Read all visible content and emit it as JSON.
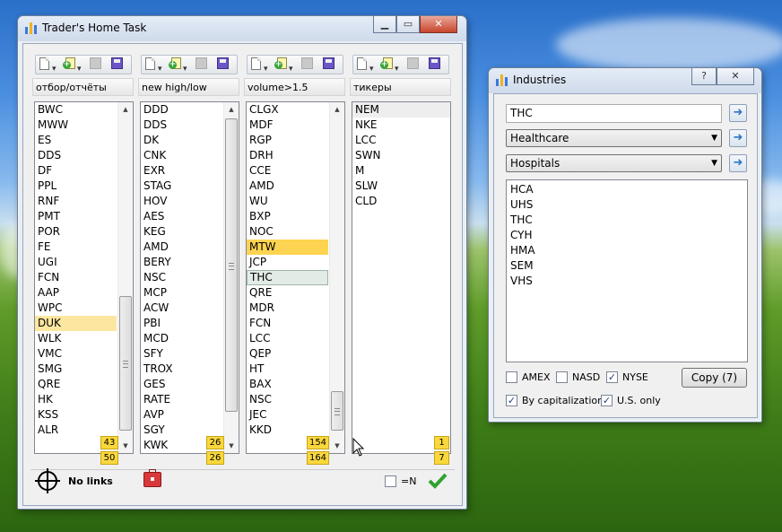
{
  "main_window": {
    "title": "Trader's Home Task",
    "columns": [
      {
        "header": "отбор/отчёты",
        "items": [
          "BWC",
          "MWW",
          "ES",
          "DDS",
          "DF",
          "PPL",
          "RNF",
          "PMT",
          "POR",
          "FE",
          "UGI",
          "FCN",
          "AAP",
          "WPC",
          "DUK",
          "WLK",
          "VMC",
          "SMG",
          "QRE",
          "HK",
          "KSS",
          "ALR"
        ],
        "selected": "DUK",
        "count_top": "43",
        "count_bottom": "50"
      },
      {
        "header": "new high/low",
        "items": [
          "DDD",
          "DDS",
          "DK",
          "CNK",
          "EXR",
          "STAG",
          "HOV",
          "AES",
          "KEG",
          "AMD",
          "BERY",
          "NSC",
          "MCP",
          "ACW",
          "PBI",
          "MCD",
          "SFY",
          "TROX",
          "GES",
          "RATE",
          "AVP",
          "SGY",
          "KWK"
        ],
        "count_top": "26",
        "count_bottom": "26"
      },
      {
        "header": "volume>1.5",
        "items": [
          "CLGX",
          "MDF",
          "RGP",
          "DRH",
          "CCE",
          "AMD",
          "WU",
          "BXP",
          "NOC",
          "MTW",
          "JCP",
          "THC",
          "QRE",
          "MDR",
          "FCN",
          "LCC",
          "QEP",
          "HT",
          "BAX",
          "NSC",
          "JEC",
          "KKD"
        ],
        "hot": "MTW",
        "focus": "THC",
        "count_top": "154",
        "count_bottom": "164"
      },
      {
        "header": "тикеры",
        "items": [
          "NEM",
          "NKE",
          "LCC",
          "SWN",
          "M",
          "SLW",
          "CLD"
        ],
        "gray": "NEM",
        "count_top": "1",
        "count_bottom": "7"
      }
    ],
    "no_links_label": "No links",
    "eq_n_label": "=N"
  },
  "industries_window": {
    "title": "Industries",
    "help_label": "?",
    "ticker_value": "THC",
    "sector": "Healthcare",
    "industry": "Hospitals",
    "results": [
      "HCA",
      "UHS",
      "THC",
      "CYH",
      "HMA",
      "SEM",
      "VHS"
    ],
    "amex_label": "AMEX",
    "nasd_label": "NASD",
    "nyse_label": "NYSE",
    "copy_label": "Copy (7)",
    "by_cap_label": "By capitalization",
    "us_only_label": "U.S. only",
    "amex_checked": false,
    "nasd_checked": false,
    "nyse_checked": true,
    "by_cap_checked": true,
    "us_only_checked": true
  },
  "colors": {
    "highlight": "#fdd451",
    "selected": "#fde6a0",
    "counter": "#fad83c",
    "check": "#2fa12f"
  }
}
